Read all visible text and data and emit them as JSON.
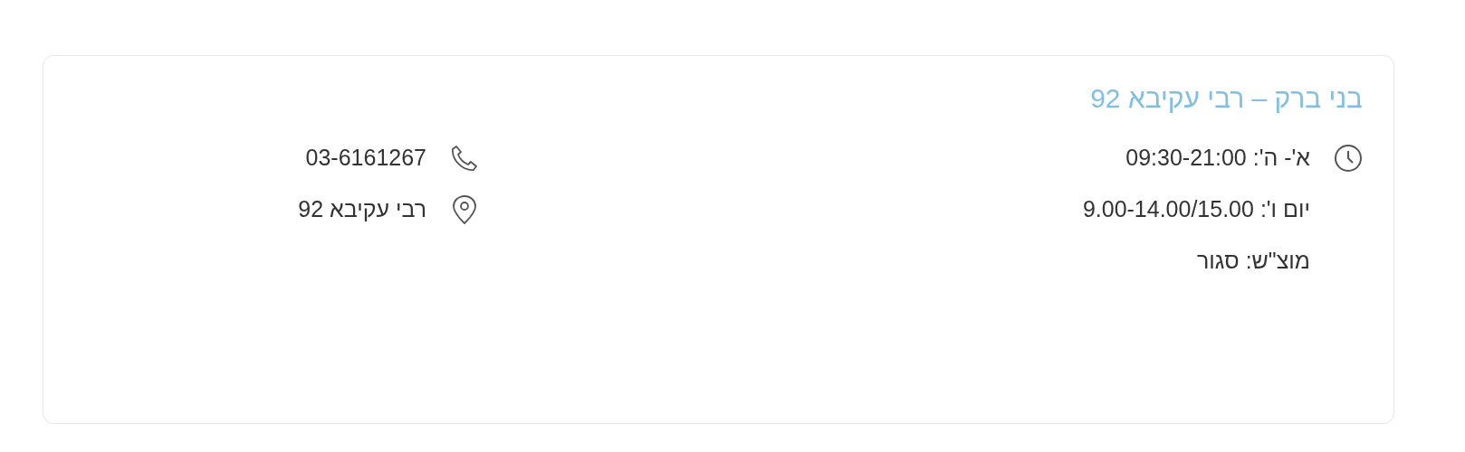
{
  "branch": {
    "title": "בני ברק – רבי עקיבא 92",
    "hours": [
      "א'- ה': 09:30-21:00",
      "יום ו': 9.00-14.00/15.00",
      "מוצ\"ש: סגור"
    ],
    "contacts": [
      {
        "kind": "phone",
        "text": "03-6161267"
      },
      {
        "kind": "address",
        "text": "רבי עקיבא 92"
      }
    ]
  }
}
